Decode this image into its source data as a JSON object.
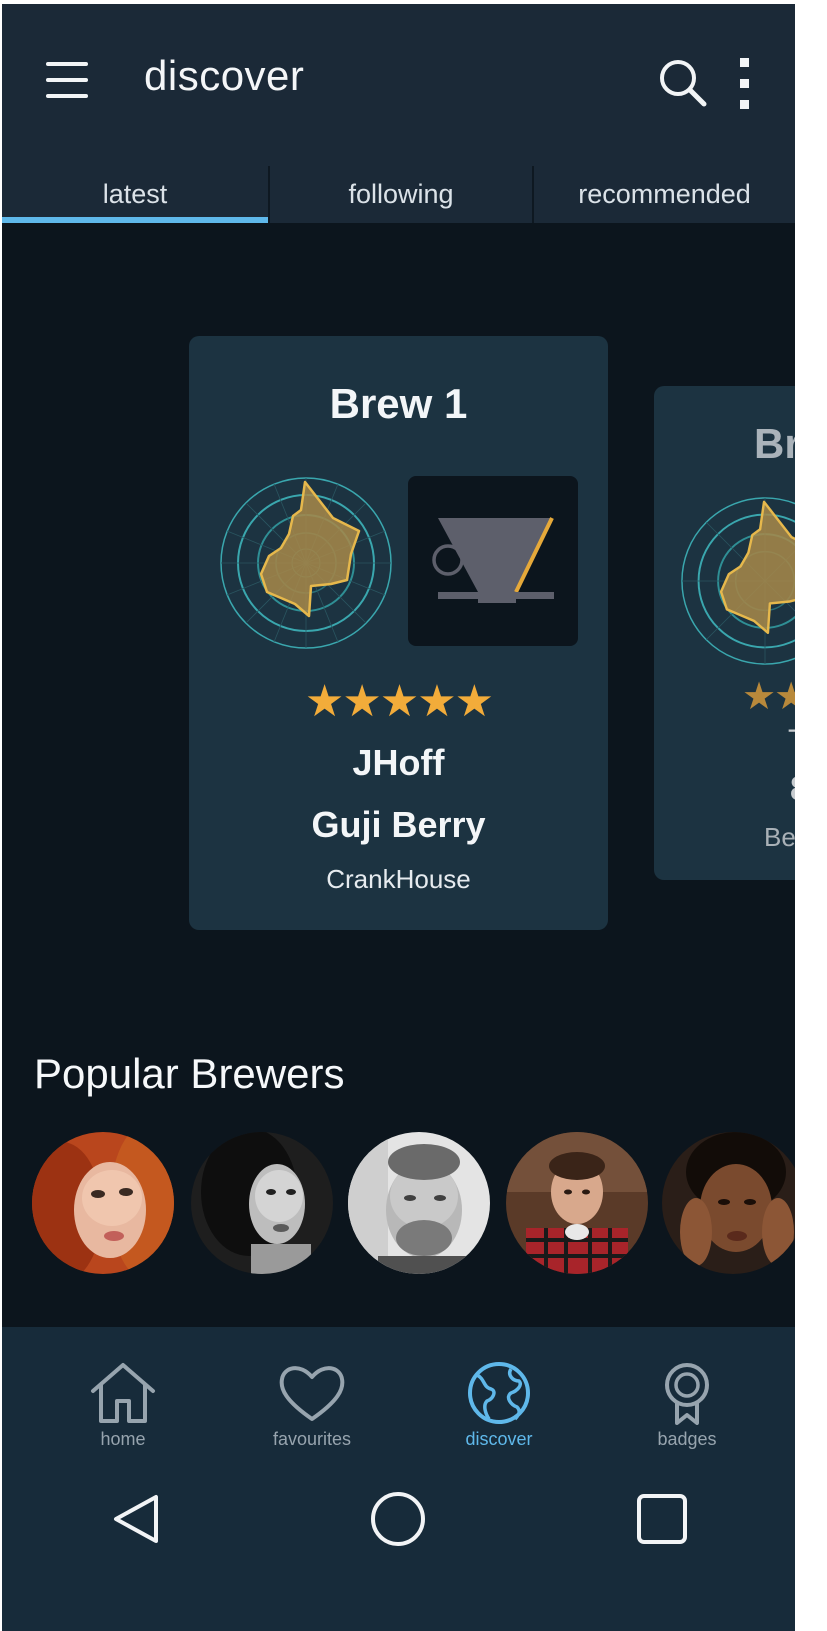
{
  "app_bar": {
    "title": "discover",
    "menu_icon": "hamburger-menu-icon",
    "search_icon": "search-icon",
    "more_icon": "more-vertical-icon"
  },
  "tabs": [
    {
      "label": "latest",
      "active": true
    },
    {
      "label": "following",
      "active": false
    },
    {
      "label": "recommended",
      "active": false
    }
  ],
  "brew_cards": [
    {
      "title": "Brew 1",
      "rating": 5,
      "stars": "★★★★★",
      "user": "JHoff",
      "bean": "Guji Berry",
      "roaster": "CrankHouse",
      "brew_method_icon": "pour-over-dripper-icon"
    },
    {
      "title": "Br",
      "stars": "★★",
      "user": "T",
      "bean": "8",
      "roaster": "Be"
    }
  ],
  "popular_brewers": {
    "title": "Popular Brewers",
    "avatars": [
      "avatar-red-hair",
      "avatar-dark-hair-bw",
      "avatar-bearded-man-bw",
      "avatar-man-plaid",
      "avatar-woman-hands"
    ]
  },
  "bottom_nav": [
    {
      "label": "home",
      "icon": "home-icon",
      "active": false
    },
    {
      "label": "favourites",
      "icon": "heart-icon",
      "active": false
    },
    {
      "label": "discover",
      "icon": "globe-icon",
      "active": true
    },
    {
      "label": "badges",
      "icon": "badge-icon",
      "active": false
    }
  ],
  "system_nav": [
    "back-triangle-icon",
    "home-circle-icon",
    "recents-square-icon"
  ],
  "colors": {
    "background": "#0c151d",
    "app_bar": "#1b2937",
    "card": "#1c3341",
    "accent": "#5fb8ea",
    "star": "#f2ac3a",
    "radar_fill": "#a88a4a"
  }
}
